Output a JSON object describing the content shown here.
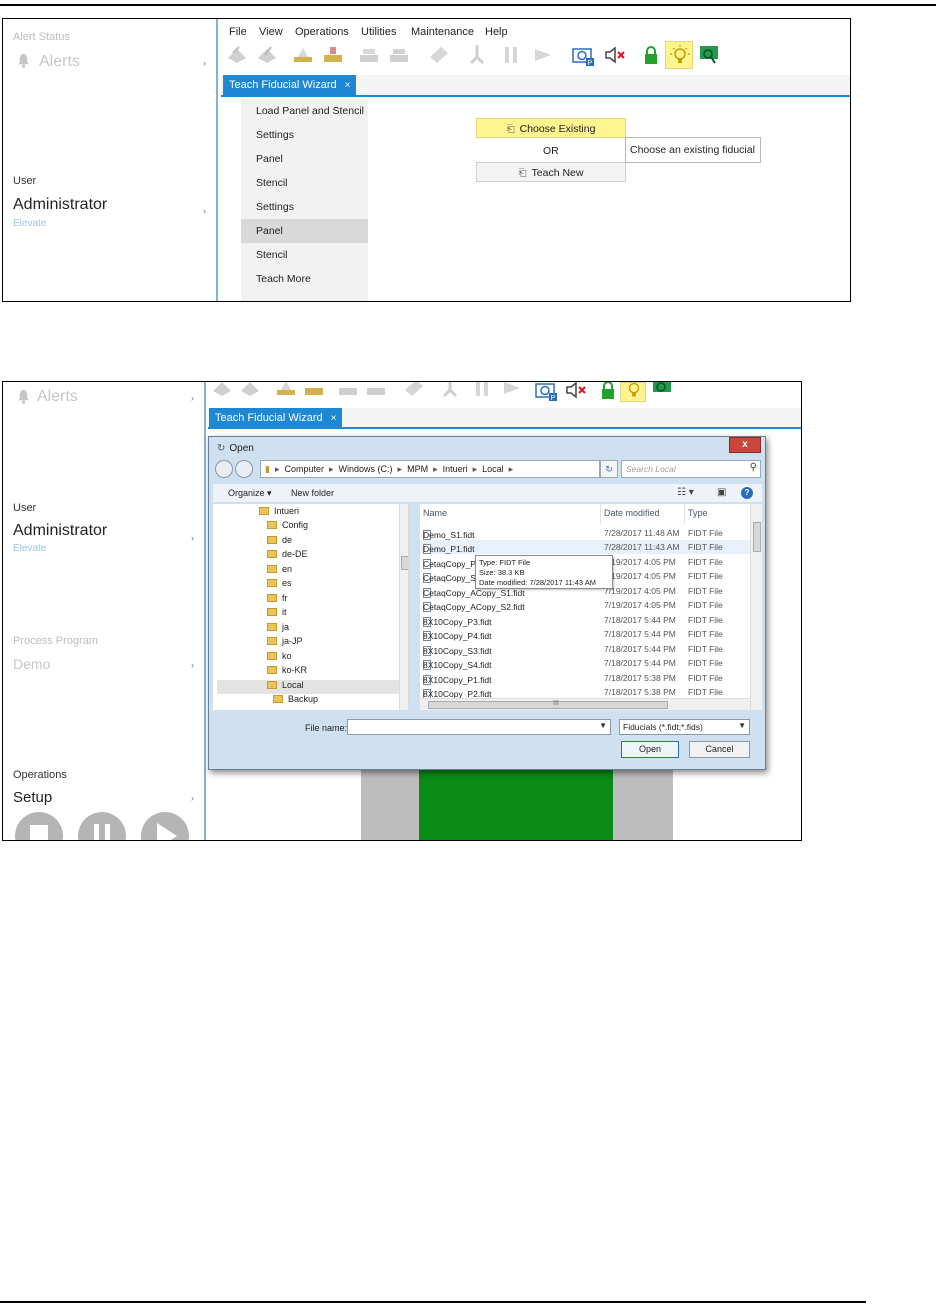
{
  "shot1": {
    "sidebar": {
      "alert_status_label": "Alert Status",
      "alerts_label": "Alerts",
      "user_label": "User",
      "user_name": "Administrator",
      "elevate_label": "Elevate"
    },
    "menu": [
      "File",
      "View",
      "Operations",
      "Utilities",
      "Maintenance",
      "Help"
    ],
    "tab": {
      "label": "Teach Fiducial Wizard",
      "close": "×"
    },
    "wizard_steps": [
      "Load Panel and Stencil",
      "Settings",
      "Panel",
      "Stencil",
      "Settings",
      "Panel",
      "Stencil",
      "Teach More"
    ],
    "selected_step": 5,
    "choose_existing": "Choose Existing",
    "or_label": "OR",
    "teach_new": "Teach New",
    "tooltip": "Choose an existing fiducial"
  },
  "shot2": {
    "sidebar": {
      "alerts_label": "Alerts",
      "user_label": "User",
      "user_name": "Administrator",
      "elevate_label": "Elevate",
      "process_program_label": "Process Program",
      "program_name": "Demo",
      "operations_label": "Operations",
      "setup_label": "Setup"
    },
    "tab": {
      "label": "Teach Fiducial Wizard",
      "close": "×"
    },
    "dialog": {
      "title": "Open",
      "close": "x",
      "path": [
        "Computer",
        "Windows (C:)",
        "MPM",
        "Intueri",
        "Local"
      ],
      "search_placeholder": "Search Local",
      "organize_label": "Organize ▾",
      "new_folder_label": "New folder",
      "help_label": "?",
      "tree": [
        "Intueri",
        "Config",
        "de",
        "de-DE",
        "en",
        "es",
        "fr",
        "it",
        "ja",
        "ja-JP",
        "ko",
        "ko-KR",
        "Local",
        "Backup"
      ],
      "columns": {
        "name": "Name",
        "date": "Date modified",
        "type": "Type"
      },
      "files": [
        {
          "name": "Demo_S1.fidt",
          "date": "7/28/2017 11:48 AM",
          "type": "FIDT File"
        },
        {
          "name": "Demo_P1.fidt",
          "date": "7/28/2017 11:43 AM",
          "type": "FIDT File"
        },
        {
          "name": "CetaqCopy_P1.fidt",
          "date": "7/19/2017 4:05 PM",
          "type": "FIDT File"
        },
        {
          "name": "CetaqCopy_S1.fidt",
          "date": "7/19/2017 4:05 PM",
          "type": "FIDT File"
        },
        {
          "name": "CetaqCopy_ACopy_S1.fidt",
          "date": "7/19/2017 4:05 PM",
          "type": "FIDT File"
        },
        {
          "name": "CetaqCopy_ACopy_S2.fidt",
          "date": "7/19/2017 4:05 PM",
          "type": "FIDT File"
        },
        {
          "name": "8X10Copy_P3.fidt",
          "date": "7/18/2017 5:44 PM",
          "type": "FIDT File"
        },
        {
          "name": "8X10Copy_P4.fidt",
          "date": "7/18/2017 5:44 PM",
          "type": "FIDT File"
        },
        {
          "name": "8X10Copy_S3.fidt",
          "date": "7/18/2017 5:44 PM",
          "type": "FIDT File"
        },
        {
          "name": "8X10Copy_S4.fidt",
          "date": "7/18/2017 5:44 PM",
          "type": "FIDT File"
        },
        {
          "name": "8X10Copy_P1.fidt",
          "date": "7/18/2017 5:38 PM",
          "type": "FIDT File"
        },
        {
          "name": "8X10Copy_P2.fidt",
          "date": "7/18/2017 5:38 PM",
          "type": "FIDT File"
        }
      ],
      "tooltip": {
        "type": "Type: FIDT File",
        "size": "Size: 38.3 KB",
        "modified": "Date modified: 7/28/2017 11:43 AM"
      },
      "file_name_label": "File name:",
      "file_name_value": "",
      "filter": "Fiducials (*.fidt;*.fids)",
      "open_label": "Open",
      "cancel_label": "Cancel"
    }
  },
  "colors": {
    "accent_blue": "#1e88d4",
    "highlight_yellow": "#fff48f",
    "board_green": "#0b8a16",
    "board_gray": "#bdbdbd"
  }
}
